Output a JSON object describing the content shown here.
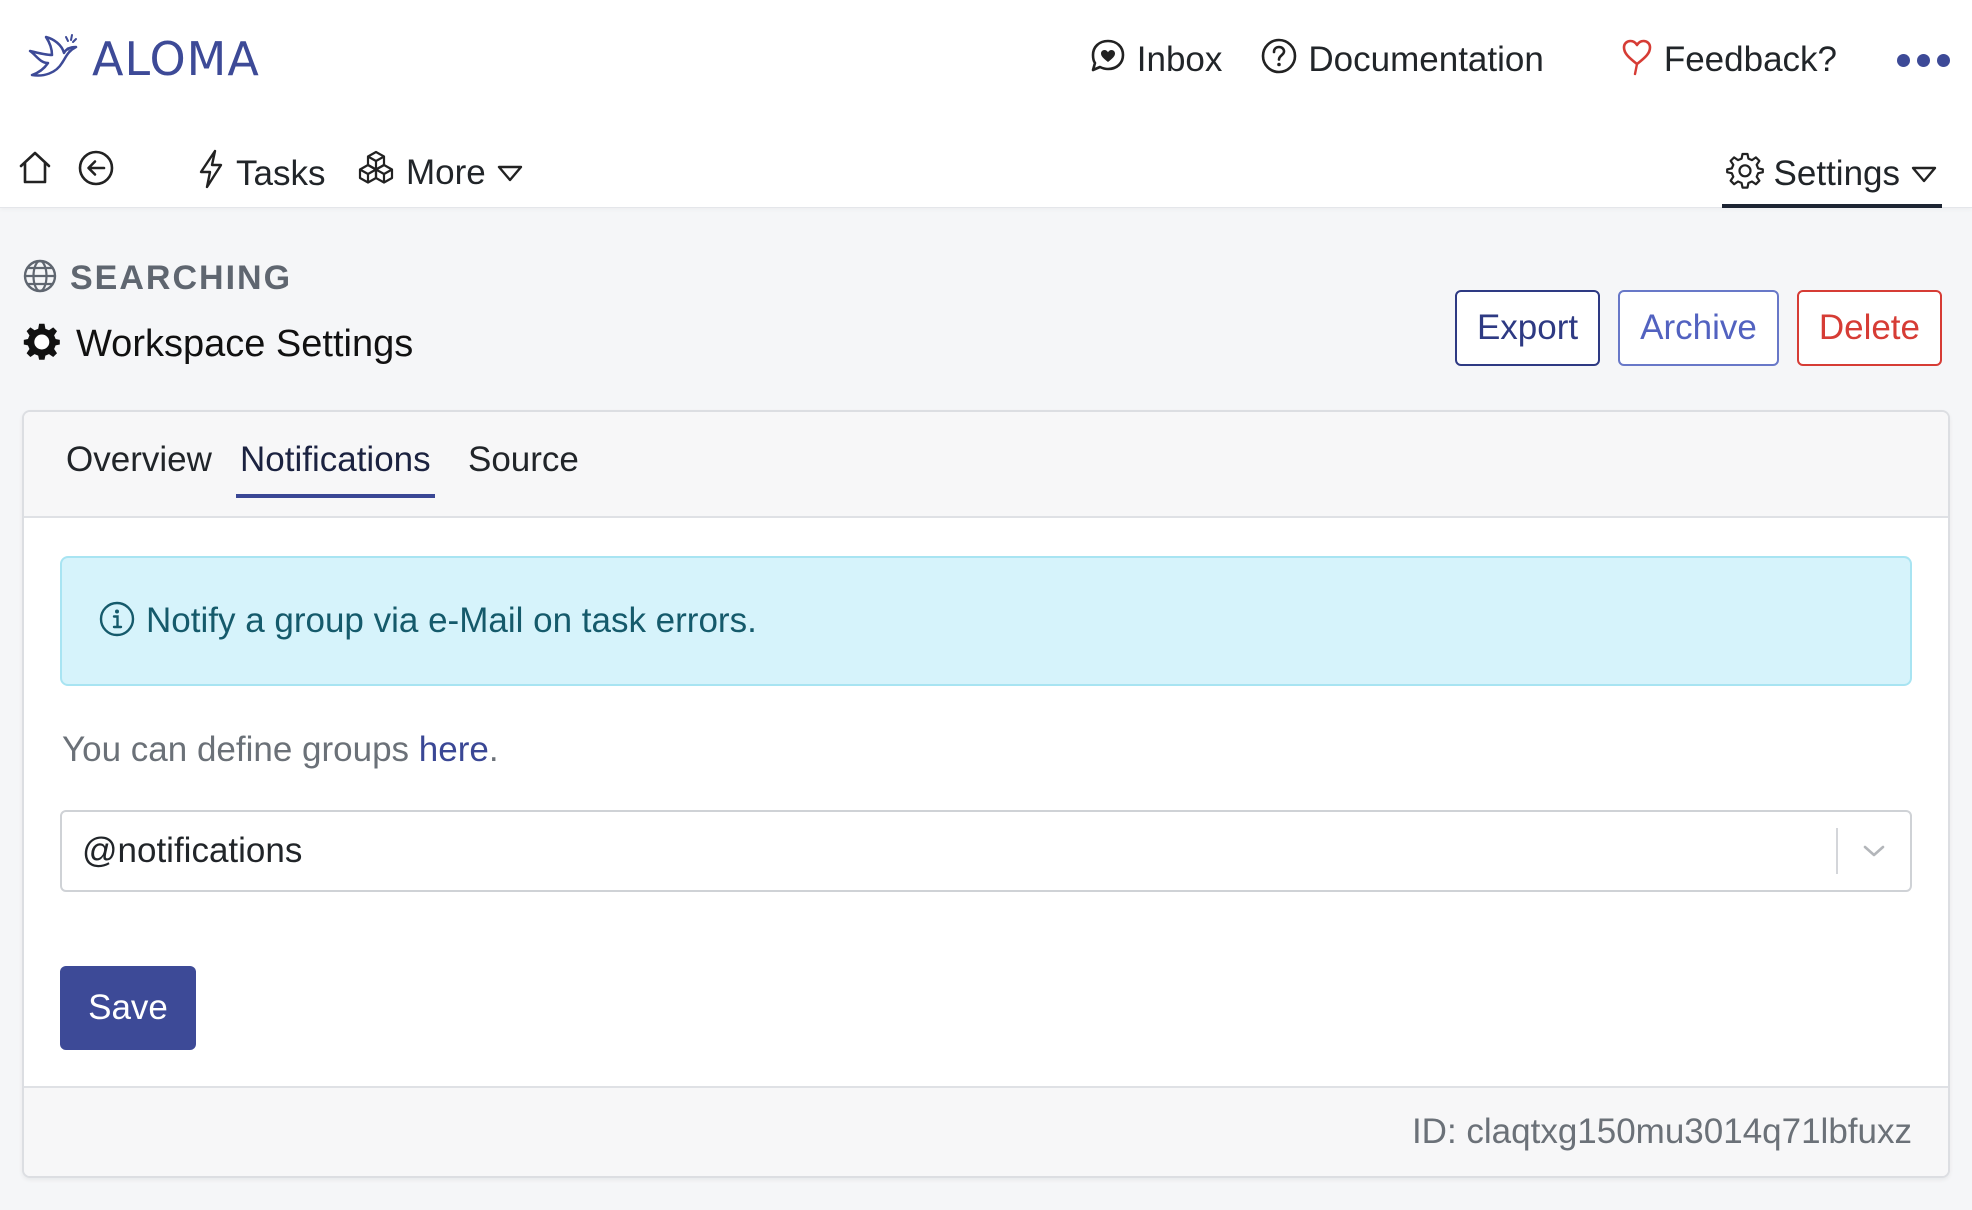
{
  "app": {
    "logo_text": "ALOMA"
  },
  "topnav": {
    "inbox_label": "Inbox",
    "documentation_label": "Documentation",
    "feedback_label": "Feedback?"
  },
  "subnav": {
    "tasks_label": "Tasks",
    "more_label": "More",
    "settings_label": "Settings"
  },
  "header": {
    "crumb": "SEARCHING",
    "title": "Workspace Settings"
  },
  "actions": {
    "export_label": "Export",
    "archive_label": "Archive",
    "delete_label": "Delete"
  },
  "tabs": [
    {
      "label": "Overview",
      "active": false
    },
    {
      "label": "Notifications",
      "active": true
    },
    {
      "label": "Source",
      "active": false
    }
  ],
  "notifications": {
    "alert_text": "Notify a group via e-Mail on task errors.",
    "helper_prefix": "You can define groups ",
    "helper_link": "here",
    "helper_suffix": ".",
    "selected_group": "@notifications",
    "save_label": "Save"
  },
  "footer": {
    "id_text": "ID: claqtxg150mu3014q71lbfuxz"
  },
  "colors": {
    "brand": "#3d4a97",
    "danger": "#d63c35",
    "info_bg": "#d6f3fb",
    "info_text": "#155a6b"
  },
  "icons": {
    "logo": "dove-logo-icon",
    "inbox": "chat-bubble-heart-icon",
    "documentation": "question-circle-icon",
    "feedback": "heart-outline-icon",
    "more_menu": "ellipsis-icon",
    "home": "home-icon",
    "back": "arrow-left-circle-icon",
    "tasks": "lightning-icon",
    "more": "boxes-icon",
    "settings": "gear-icon",
    "crumb": "globe-icon",
    "title": "gear-solid-icon",
    "alert": "info-circle-icon",
    "select": "chevron-down-icon"
  }
}
